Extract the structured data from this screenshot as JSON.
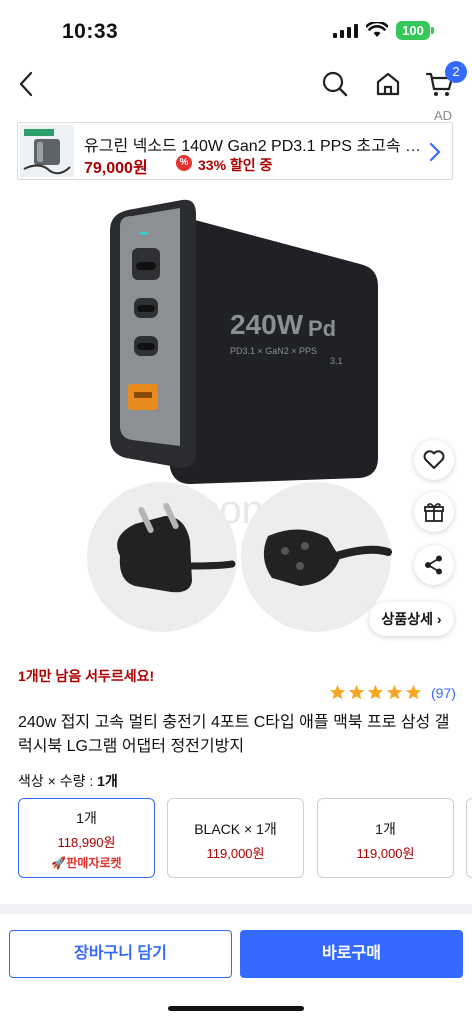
{
  "status_bar": {
    "time": "10:33",
    "battery": "100"
  },
  "nav": {
    "cart_count": "2"
  },
  "ad": {
    "mark": "AD",
    "title": "유그린 넥소드 140W Gan2 PD3.1 PPS 초고속 멀티...",
    "price": "79,000원",
    "coupon_icon_text": "%",
    "discount": "33% 할인 중"
  },
  "gallery": {
    "detail_button": "상품상세 ›",
    "watermark": "congcongmall",
    "charger_label": "240W",
    "charger_sub": "PD3.1 × GaN2 × PPS",
    "charger_pd": "Pd",
    "charger_pd_ver": "3.1"
  },
  "product": {
    "stock_notice": "1개만 남음 서두르세요!",
    "rating_stars": 5,
    "review_count": "(97)",
    "title": "240w 접지 고속 멀티 충전기 4포트 C타입 애플 맥북 프로 삼성 갤럭시북 LG그램 어댑터 정전기방지"
  },
  "options": {
    "label_prefix": "색상 × 수량 : ",
    "label_value": "1개",
    "items": [
      {
        "name": "1개",
        "price": "118,990원",
        "tag": "🚀판매자로켓",
        "selected": true
      },
      {
        "name": "BLACK × 1개",
        "price": "119,000원"
      },
      {
        "name": "1개",
        "price": "119,000원"
      }
    ]
  },
  "bottom": {
    "cart_button": "장바구니 담기",
    "buy_button": "바로구매"
  },
  "colors": {
    "accent": "#346aff",
    "price_red": "#ae0000",
    "star": "#f5a623",
    "battery": "#34c759"
  }
}
